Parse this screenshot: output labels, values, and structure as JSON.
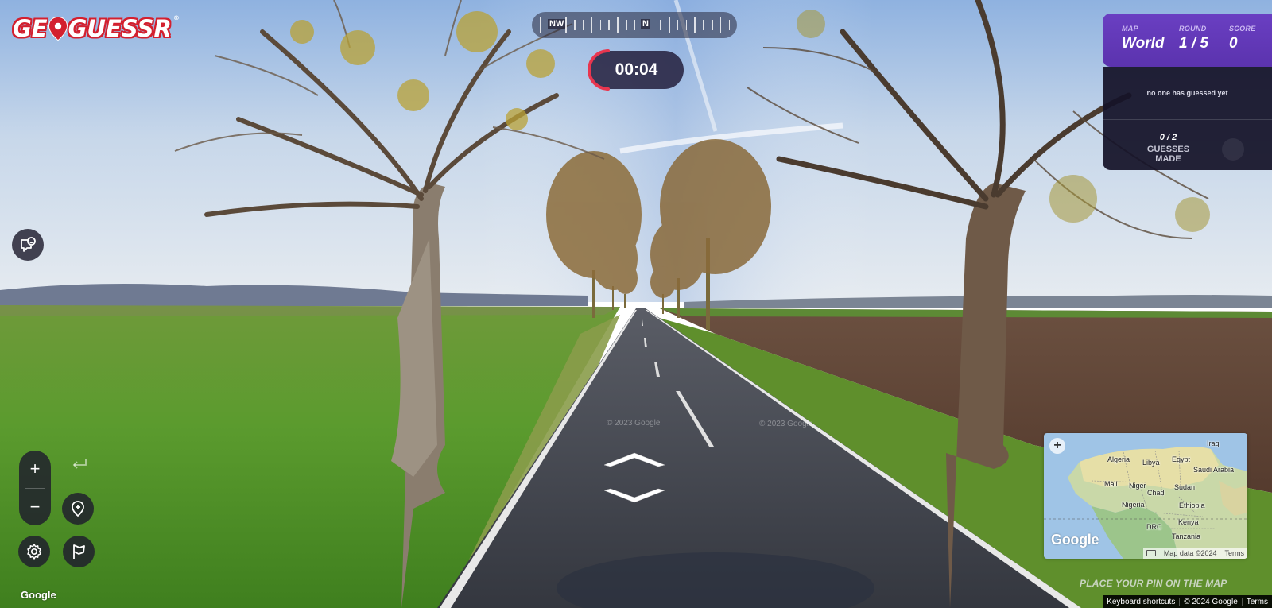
{
  "logo": {
    "text_left": "GE",
    "text_right": "GUESSR",
    "trademark": "®"
  },
  "compass": {
    "labels": [
      "NW",
      "N"
    ]
  },
  "timer": {
    "value": "00:04",
    "progress": 0.12
  },
  "status": {
    "map_label": "MAP",
    "map_value": "World",
    "round_label": "ROUND",
    "round_value": "1 / 5",
    "score_label": "SCORE",
    "score_value": "0",
    "no_guess_text": "no one has guessed yet",
    "guesses_count": "0 / 2",
    "guesses_label": "GUESSES MADE"
  },
  "controls": {
    "icons": [
      "chat-icon",
      "zoom-in-icon",
      "zoom-out-icon",
      "return-icon",
      "add-pin-icon",
      "settings-icon",
      "flag-icon"
    ],
    "zoom_in": "+",
    "zoom_out": "−"
  },
  "streetview": {
    "watermark": "© 2023 Google",
    "google_label": "Google"
  },
  "minimap": {
    "labels": [
      "Algeria",
      "Libya",
      "Egypt",
      "Iraq",
      "Saudi Arabia",
      "Mali",
      "Niger",
      "Chad",
      "Sudan",
      "Nigeria",
      "Ethiopia",
      "Kenya",
      "DRC",
      "Tanzania"
    ],
    "google": "Google",
    "map_data": "Map data ©2024",
    "terms": "Terms",
    "place_pin": "PLACE YOUR PIN ON THE MAP"
  },
  "footer": {
    "keyboard": "Keyboard shortcuts",
    "copyright": "© 2024 Google",
    "terms": "Terms"
  },
  "colors": {
    "accent_purple": "#6a3fc2",
    "timer_red": "#e8364f",
    "logo_red": "#d3202f"
  }
}
